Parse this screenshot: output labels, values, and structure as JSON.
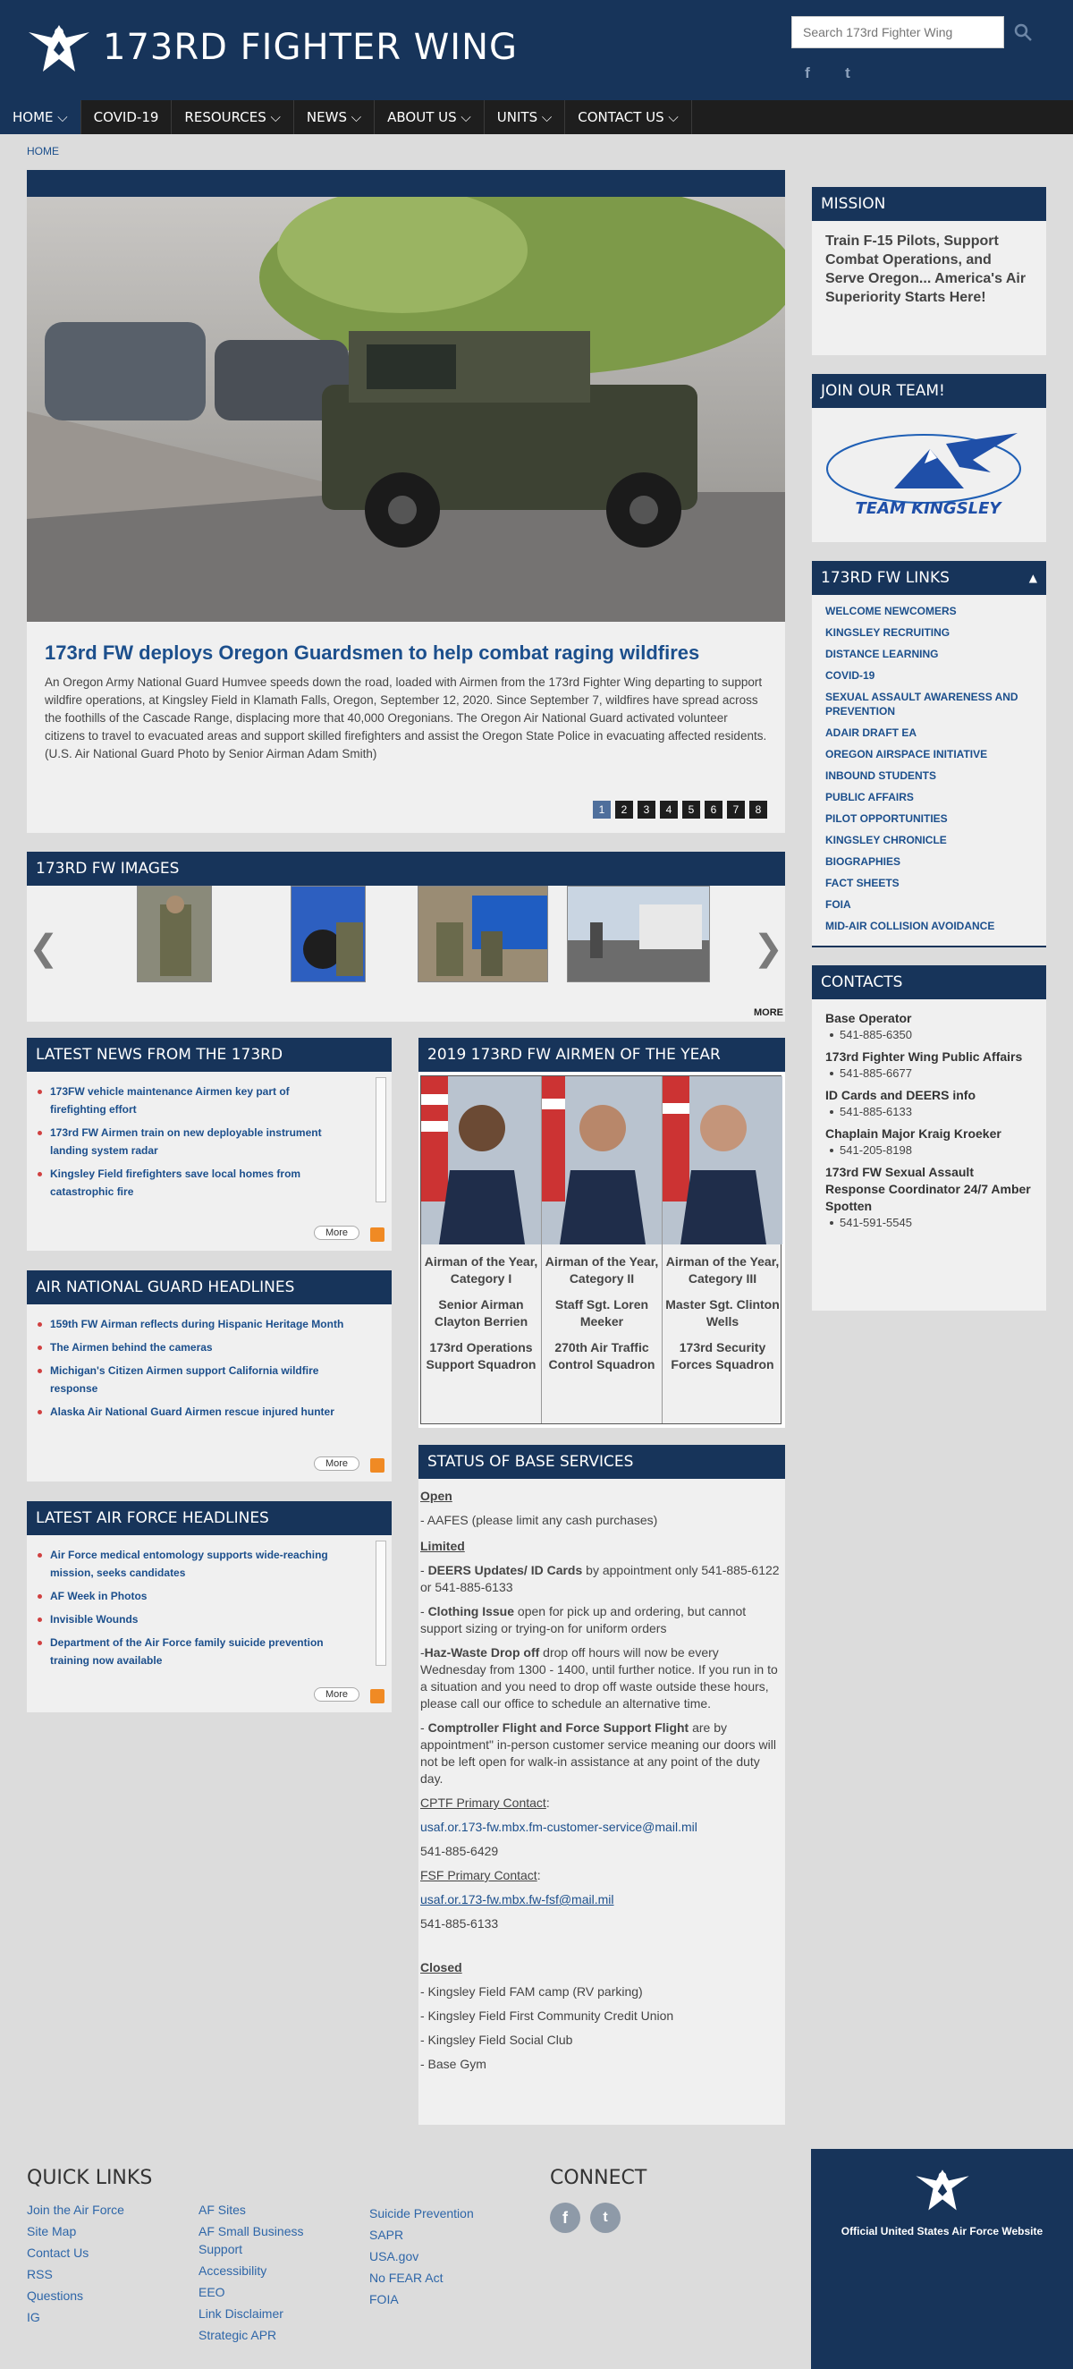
{
  "header": {
    "site_title": "173RD FIGHTER WING",
    "search_placeholder": "Search 173rd Fighter Wing",
    "search_icon": "search-icon",
    "social": [
      "f",
      "t"
    ]
  },
  "nav": [
    {
      "label": "HOME ⌵"
    },
    {
      "label": "COVID-19"
    },
    {
      "label": "RESOURCES ⌵"
    },
    {
      "label": "NEWS ⌵"
    },
    {
      "label": "ABOUT US ⌵"
    },
    {
      "label": "UNITS ⌵"
    },
    {
      "label": "CONTACT US ⌵"
    }
  ],
  "breadcrumb": "HOME",
  "hero": {
    "title": "173rd FW deploys Oregon Guardsmen to help combat raging wildfires",
    "text": "An Oregon Army National Guard Humvee speeds down the road, loaded with Airmen from the 173rd Fighter Wing departing to support wildfire operations, at Kingsley Field in Klamath Falls, Oregon, September 12, 2020. Since September 7, wildfires have spread across the foothills of the Cascade Range, displacing more that 40,000 Oregonians. The Oregon Air National Guard activated volunteer citizens to travel to evacuated areas and support skilled firefighters and assist the Oregon State Police in evacuating affected residents. (U.S. Air National Guard Photo by Senior Airman Adam Smith)",
    "pages": [
      "1",
      "2",
      "3",
      "4",
      "5",
      "6",
      "7",
      "8"
    ],
    "active_page": "1"
  },
  "images": {
    "title": "173RD FW IMAGES",
    "more": "MORE"
  },
  "latest_news": {
    "title": "LATEST NEWS FROM THE 173RD",
    "items": [
      "173FW vehicle maintenance Airmen key part of firefighting effort",
      "173rd FW Airmen train on new deployable instrument landing system radar",
      "Kingsley Field firefighters save local homes from catastrophic fire"
    ],
    "more": "More"
  },
  "ang_headlines": {
    "title": "AIR NATIONAL GUARD HEADLINES",
    "items": [
      "159th FW Airman reflects during Hispanic Heritage Month",
      "The Airmen behind the cameras",
      "Michigan's Citizen Airmen support California wildfire response",
      "Alaska Air National Guard Airmen rescue injured hunter"
    ],
    "more": "More"
  },
  "af_headlines": {
    "title": "LATEST AIR FORCE HEADLINES",
    "items": [
      "Air Force medical entomology supports wide-reaching mission, seeks candidates",
      "AF Week in Photos",
      "Invisible Wounds",
      "Department of the Air Force family suicide prevention training now available"
    ],
    "more": "More"
  },
  "aoy": {
    "title": "2019 173RD FW AIRMEN OF THE YEAR",
    "people": [
      {
        "category": "Airman of the Year, Category I",
        "name": "Senior Airman Clayton Berrien",
        "unit": "173rd Operations Support Squadron"
      },
      {
        "category": "Airman of the Year, Category II",
        "name": "Staff Sgt. Loren Meeker",
        "unit": "270th Air Traffic Control Squadron"
      },
      {
        "category": "Airman of the Year, Category III",
        "name": "Master Sgt. Clinton Wells",
        "unit": "173rd Security Forces Squadron"
      }
    ]
  },
  "status": {
    "title": "STATUS OF BASE SERVICES",
    "open_h": "Open",
    "open_1": "- AAFES (please limit any cash purchases)",
    "limited_h": "Limited",
    "deers_b": "DEERS Updates/ ID Cards",
    "deers_t": " by appointment only 541-885-6122 or 541-885-6133",
    "cloth_b": "Clothing Issue",
    "cloth_t": " open for pick up and ordering, but cannot support sizing or trying-on for uniform orders",
    "haz_b": "Haz-Waste Drop off",
    "haz_t": "  drop off hours will now be every Wednesday from 1300 - 1400, until further notice. If you run in to a situation and you need to drop off waste outside these hours, please call our office to schedule an alternative time.",
    "comp_b": "Comptroller Flight and Force Support Flight",
    "comp_t": " are by appointment\" in-person customer service meaning our doors will not be left open for walk-in assistance at any point of the duty day.",
    "cptf_label": "CPTF Primary Contact",
    "cptf_email": "usaf.or.173-fw.mbx.fm-customer-service@mail.mil",
    "cptf_phone": "541-885-6429",
    "fsf_label": "FSF Primary Contact",
    "fsf_email": "usaf.or.173-fw.mbx.fw-fsf@mail.mil",
    "fsf_phone": "541-885-6133",
    "closed_h": "Closed",
    "closed": [
      "- Kingsley Field FAM camp (RV parking)",
      "- Kingsley Field First Community Credit Union",
      "- Kingsley Field Social Club",
      "- Base Gym"
    ]
  },
  "mission": {
    "title": "MISSION",
    "text": "Train F-15 Pilots, Support Combat Operations, and Serve Oregon... America's Air Superiority Starts Here!"
  },
  "join": {
    "title": "JOIN OUR TEAM!",
    "logo_text": "TEAM KINGSLEY"
  },
  "links": {
    "title": "173RD FW LINKS",
    "items": [
      "WELCOME NEWCOMERS",
      "KINGSLEY RECRUITING",
      "DISTANCE LEARNING",
      "COVID-19",
      "SEXUAL ASSAULT AWARENESS AND PREVENTION",
      "ADAIR DRAFT EA",
      "OREGON AIRSPACE INITIATIVE",
      "INBOUND STUDENTS",
      "PUBLIC AFFAIRS",
      "PILOT OPPORTUNITIES",
      "KINGSLEY CHRONICLE",
      "BIOGRAPHIES",
      "FACT SHEETS",
      "FOIA",
      "MID-AIR COLLISION AVOIDANCE"
    ]
  },
  "contacts": {
    "title": "CONTACTS",
    "items": [
      {
        "name": "Base Operator",
        "phone": "541-885-6350"
      },
      {
        "name": "173rd Fighter Wing Public Affairs",
        "phone": "541-885-6677"
      },
      {
        "name": "ID Cards and DEERS info",
        "phone": "541-885-6133"
      },
      {
        "name": "Chaplain Major Kraig Kroeker",
        "phone": "541-205-8198"
      },
      {
        "name": "173rd FW Sexual Assault Response Coordinator 24/7 Amber Spotten",
        "phone": "541-591-5545"
      }
    ]
  },
  "footer": {
    "quick_links_title": "QUICK LINKS",
    "col1": [
      "Join the Air Force",
      "Site Map",
      "Contact Us",
      "RSS",
      "Questions",
      "IG"
    ],
    "col2": [
      "AF Sites",
      "AF Small Business Support",
      "Accessibility",
      "EEO",
      "Link Disclaimer",
      "Strategic APR"
    ],
    "col3": [
      "Suicide Prevention",
      "SAPR",
      "USA.gov",
      "No FEAR Act",
      "FOIA"
    ],
    "connect_title": "CONNECT",
    "official": "Official United States Air Force Website"
  },
  "colors": {
    "brand_navy": "#17345a",
    "nav_dark": "#1e1e1e",
    "link_blue": "#1c4f8c",
    "rss_orange": "#f08a24"
  }
}
